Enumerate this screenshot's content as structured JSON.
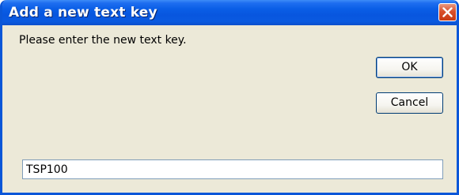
{
  "dialog": {
    "title": "Add a new text key",
    "message": "Please enter the new text key.",
    "ok_label": "OK",
    "cancel_label": "Cancel",
    "input_value": "TSP100"
  },
  "colors": {
    "titlebar": "#0a5ee6",
    "window_bg": "#ece9d8",
    "close_button": "#d9502b"
  },
  "icons": {
    "close": "close-icon"
  }
}
